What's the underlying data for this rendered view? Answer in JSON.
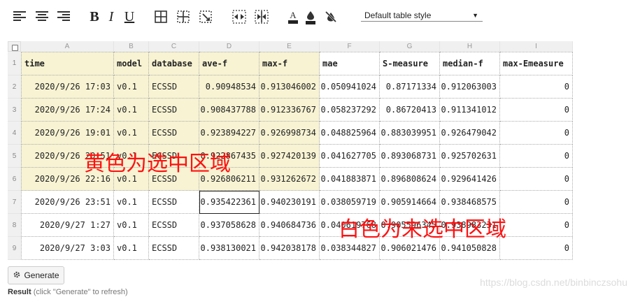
{
  "toolbar": {
    "bold_label": "B",
    "italic_label": "I",
    "underline_label": "U",
    "table_style": "Default table style",
    "icons": [
      "align-left-icon",
      "align-center-icon",
      "align-right-icon",
      "bold-icon",
      "italic-icon",
      "underline-icon",
      "all-borders-icon",
      "inner-borders-icon",
      "clear-borders-icon",
      "expand-columns-icon",
      "shrink-columns-icon",
      "text-color-icon",
      "fill-color-icon",
      "clear-format-icon"
    ]
  },
  "grid": {
    "columns": [
      "A",
      "B",
      "C",
      "D",
      "E",
      "F",
      "G",
      "H",
      "I"
    ],
    "rows": [
      "1",
      "2",
      "3",
      "4",
      "5",
      "6",
      "7",
      "8",
      "9"
    ],
    "header": [
      "time",
      "model",
      "database",
      "ave-f",
      "max-f",
      "mae",
      "S-measure",
      "median-f",
      "max-Emeasure"
    ],
    "data": [
      [
        "2020/9/26 17:03",
        "v0.1",
        "ECSSD",
        "0.90948534",
        "0.913046002",
        "0.050941024",
        "0.87171334",
        "0.912063003",
        "0"
      ],
      [
        "2020/9/26 17:24",
        "v0.1",
        "ECSSD",
        "0.908437788",
        "0.912336767",
        "0.058237292",
        "0.86720413",
        "0.911341012",
        "0"
      ],
      [
        "2020/9/26 19:01",
        "v0.1",
        "ECSSD",
        "0.923894227",
        "0.926998734",
        "0.048825964",
        "0.883039951",
        "0.926479042",
        "0"
      ],
      [
        "2020/9/26 20:51",
        "v0.1",
        "ECSSD",
        "0.922867435",
        "0.927420139",
        "0.041627705",
        "0.893068731",
        "0.925702631",
        "0"
      ],
      [
        "2020/9/26 22:16",
        "v0.1",
        "ECSSD",
        "0.926806211",
        "0.931262672",
        "0.041883871",
        "0.896808624",
        "0.929641426",
        "0"
      ],
      [
        "2020/9/26 23:51",
        "v0.1",
        "ECSSD",
        "0.935422361",
        "0.940230191",
        "0.038059719",
        "0.905914664",
        "0.938468575",
        "0"
      ],
      [
        "2020/9/27 1:27",
        "v0.1",
        "ECSSD",
        "0.937058628",
        "0.940684736",
        "0.040619768",
        "0.905596345",
        "0.938983231",
        "0"
      ],
      [
        "2020/9/27 3:03",
        "v0.1",
        "ECSSD",
        "0.938130021",
        "0.942038178",
        "0.038344827",
        "0.906021476",
        "0.941050828",
        "0"
      ]
    ]
  },
  "annotations": {
    "selected": "黄色为选中区域",
    "unselected": "白色为未选中区域"
  },
  "generate_label": "Generate",
  "result_label": "Result",
  "result_hint": "(click \"Generate\" to refresh)",
  "watermark": "https://blog.csdn.net/binbinczsohu",
  "colors": {
    "selection": "#f7f3d3",
    "annotation": "#ff1111"
  }
}
